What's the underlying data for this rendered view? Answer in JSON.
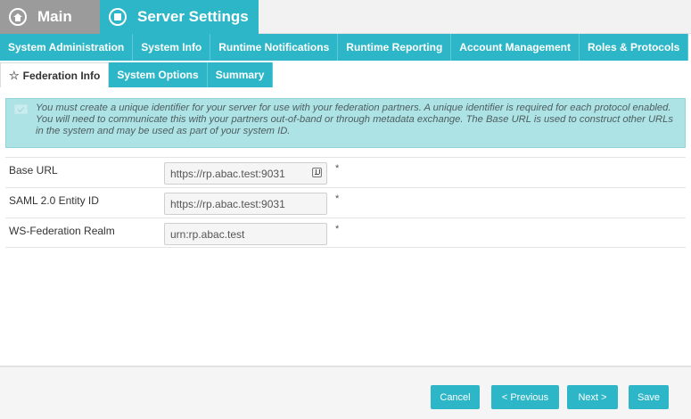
{
  "header": {
    "main_label": "Main",
    "server_label": "Server Settings"
  },
  "nav_secondary": [
    {
      "label": "System Administration"
    },
    {
      "label": "System Info"
    },
    {
      "label": "Runtime Notifications"
    },
    {
      "label": "Runtime Reporting"
    },
    {
      "label": "Account Management"
    },
    {
      "label": "Roles & Protocols"
    }
  ],
  "nav_tertiary": [
    {
      "label": "Federation Info",
      "active": true
    },
    {
      "label": "System Options",
      "active": false
    },
    {
      "label": "Summary",
      "active": false
    }
  ],
  "info_message": "You must create a unique identifier for your server for use with your federation partners. A unique identifier is required for each protocol enabled. You will need to communicate this with your partners out-of-band or through metadata exchange. The Base URL is used to construct other URLs in the system and may be used as part of your system ID.",
  "form": {
    "rows": [
      {
        "label": "Base URL",
        "value": "https://rp.abac.test:9031",
        "required_mark": "*"
      },
      {
        "label": "SAML 2.0 Entity ID",
        "value": "https://rp.abac.test:9031",
        "required_mark": "*"
      },
      {
        "label": "WS-Federation Realm",
        "value": "urn:rp.abac.test",
        "required_mark": "*"
      }
    ]
  },
  "footer": {
    "cancel_label": "Cancel",
    "previous_label": "< Previous",
    "next_label": "Next >",
    "save_label": "Save"
  },
  "colors": {
    "accent": "#2db6c7",
    "main_tab": "#9b9b9b",
    "info_bg": "#aee3e5"
  }
}
